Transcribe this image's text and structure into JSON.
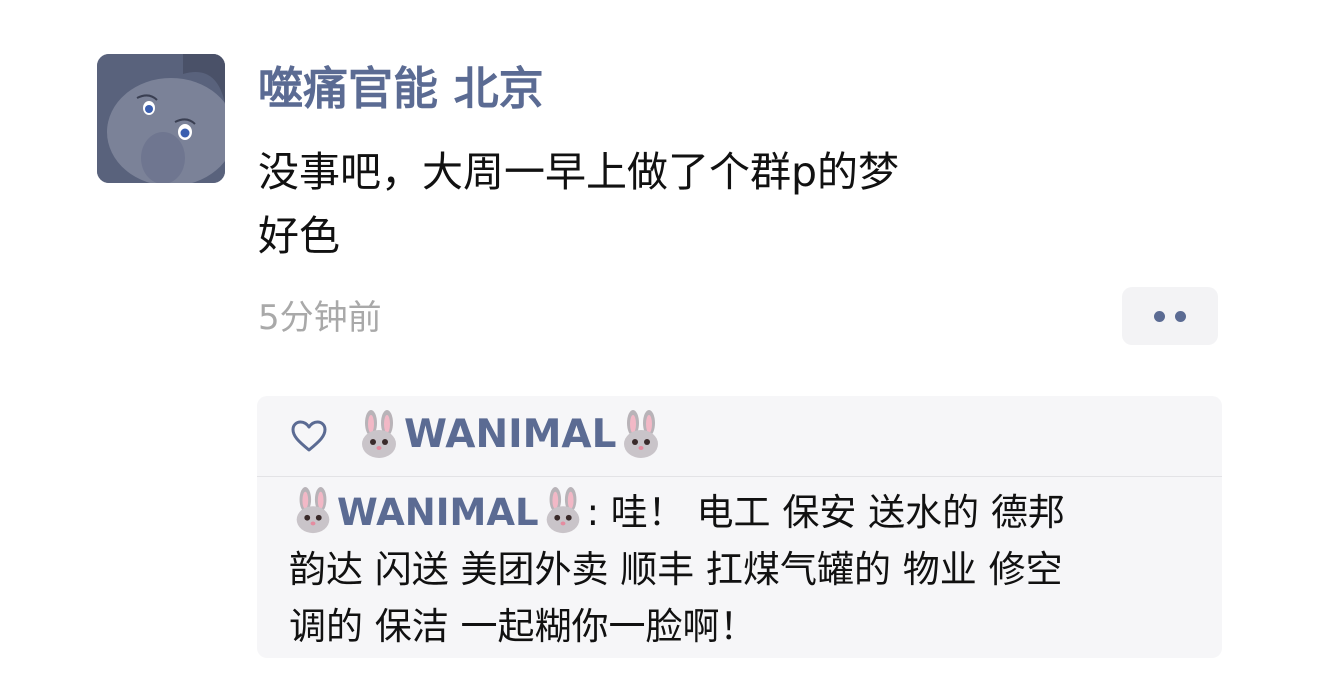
{
  "post": {
    "author": "噬痛官能 北京",
    "content_lines": [
      "没事吧，大周一早上做了个群p的梦",
      "好色"
    ],
    "timestamp": "5分钟前"
  },
  "likes": {
    "name": "WANIMAL"
  },
  "comment": {
    "author": "WANIMAL",
    "separator": ": ",
    "text_line1": "哇！ 电工 保安 送水的 德邦",
    "text_line2": "韵达 闪送 美团外卖 顺丰 扛煤气罐的 物业 修空",
    "text_line3": "调的 保洁 一起糊你一脸啊！"
  },
  "icons": {
    "heart": "heart-outline-icon",
    "more": "more-dots-icon",
    "rabbit": "rabbit-face-emoji"
  },
  "colors": {
    "name_blue": "#5b6b93",
    "timestamp_gray": "#a9a9a9",
    "panel_bg": "#f6f6f8"
  }
}
